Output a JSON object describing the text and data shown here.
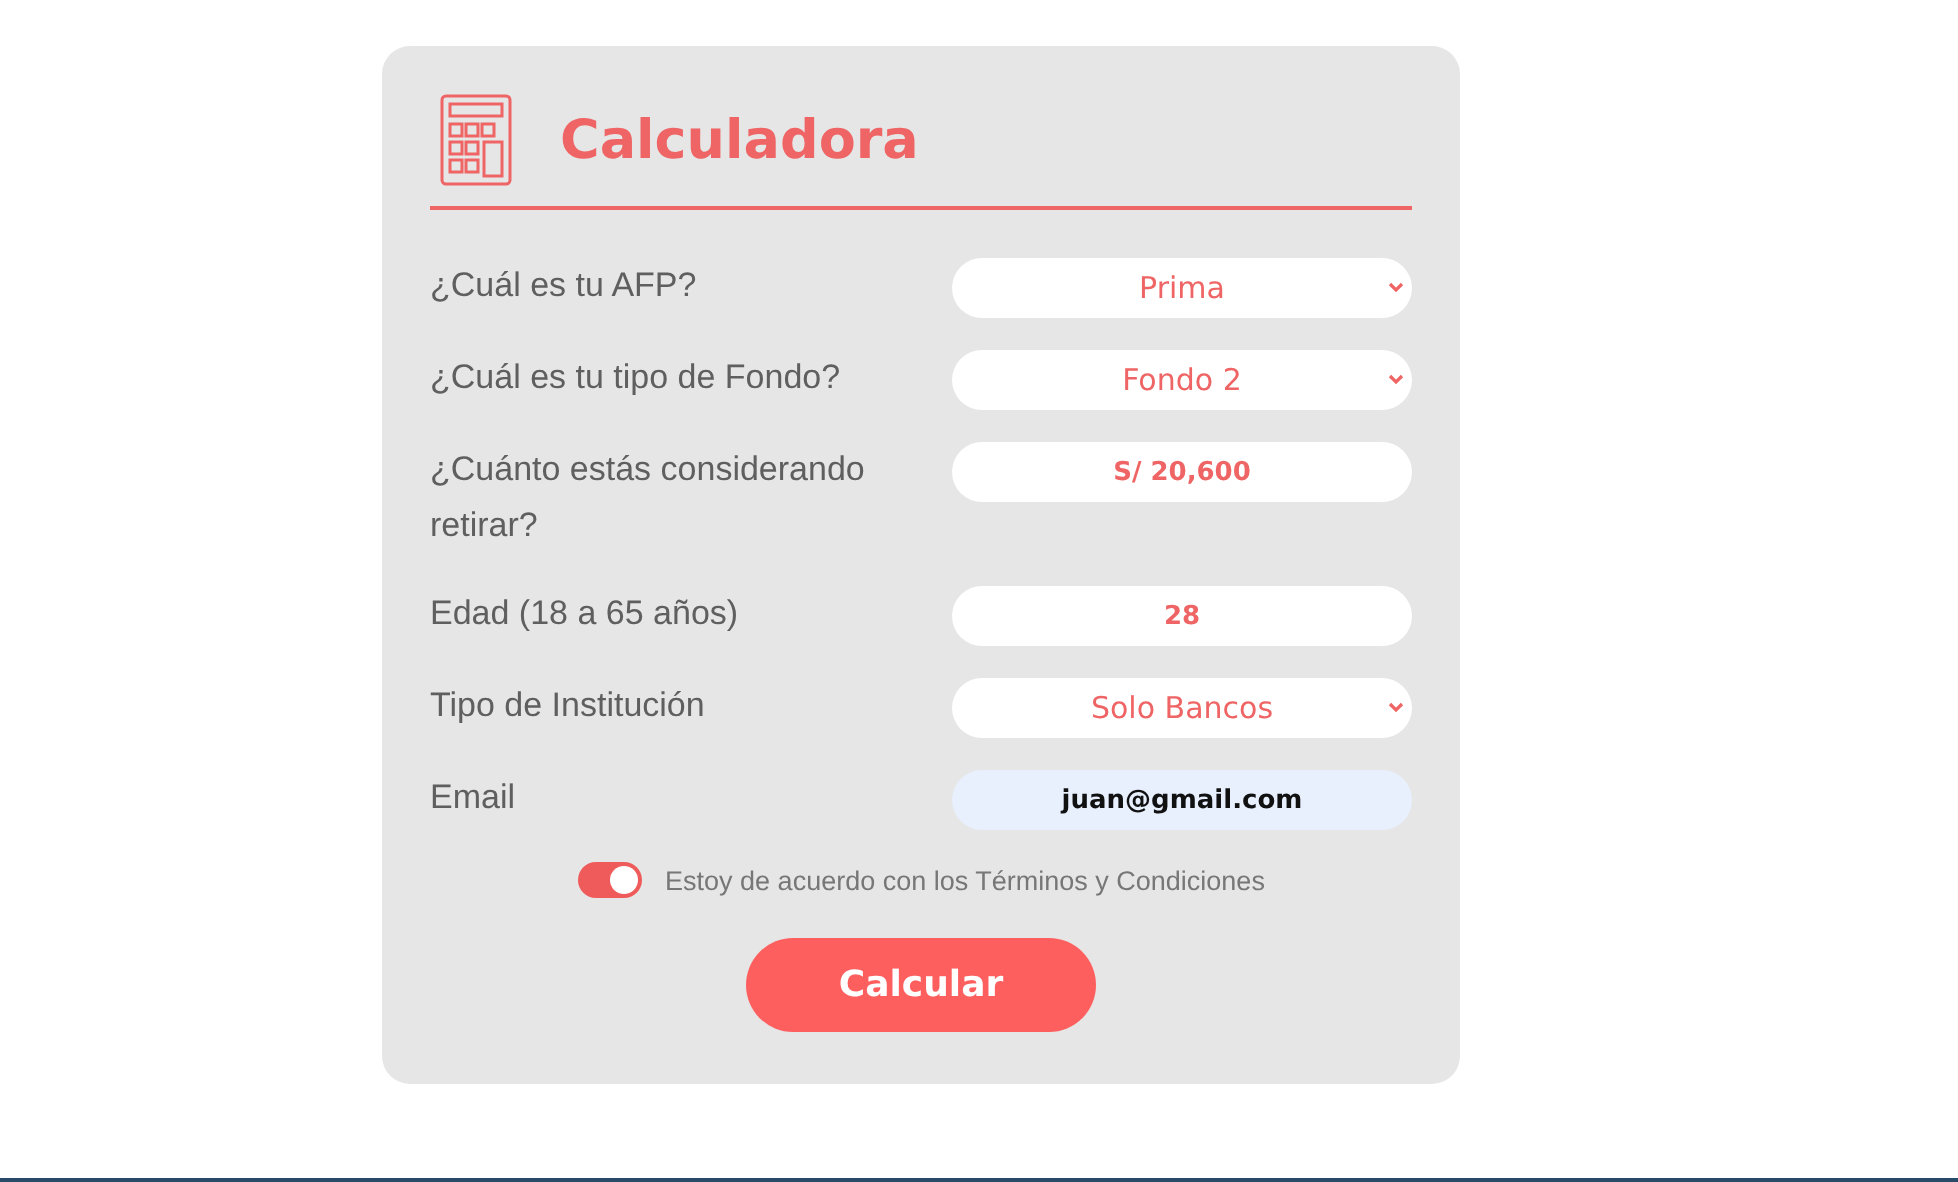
{
  "title": "Calculadora",
  "fields": [
    {
      "label": "¿Cuál es tu AFP?",
      "kind": "select",
      "value": "Prima"
    },
    {
      "label": "¿Cuál es tu tipo de Fondo?",
      "kind": "select",
      "value": "Fondo 2"
    },
    {
      "label": "¿Cuánto estás considerando retirar?",
      "kind": "input",
      "value": "S/ 20,600"
    },
    {
      "label": "Edad (18 a 65 años)",
      "kind": "input",
      "value": "28"
    },
    {
      "label": "Tipo de Institución",
      "kind": "select",
      "value": "Solo Bancos"
    },
    {
      "label": "Email",
      "kind": "email",
      "value": "juan@gmail.com"
    }
  ],
  "terms": {
    "label": "Estoy de acuerdo con los Términos y Condiciones",
    "on": true
  },
  "button": "Calcular"
}
